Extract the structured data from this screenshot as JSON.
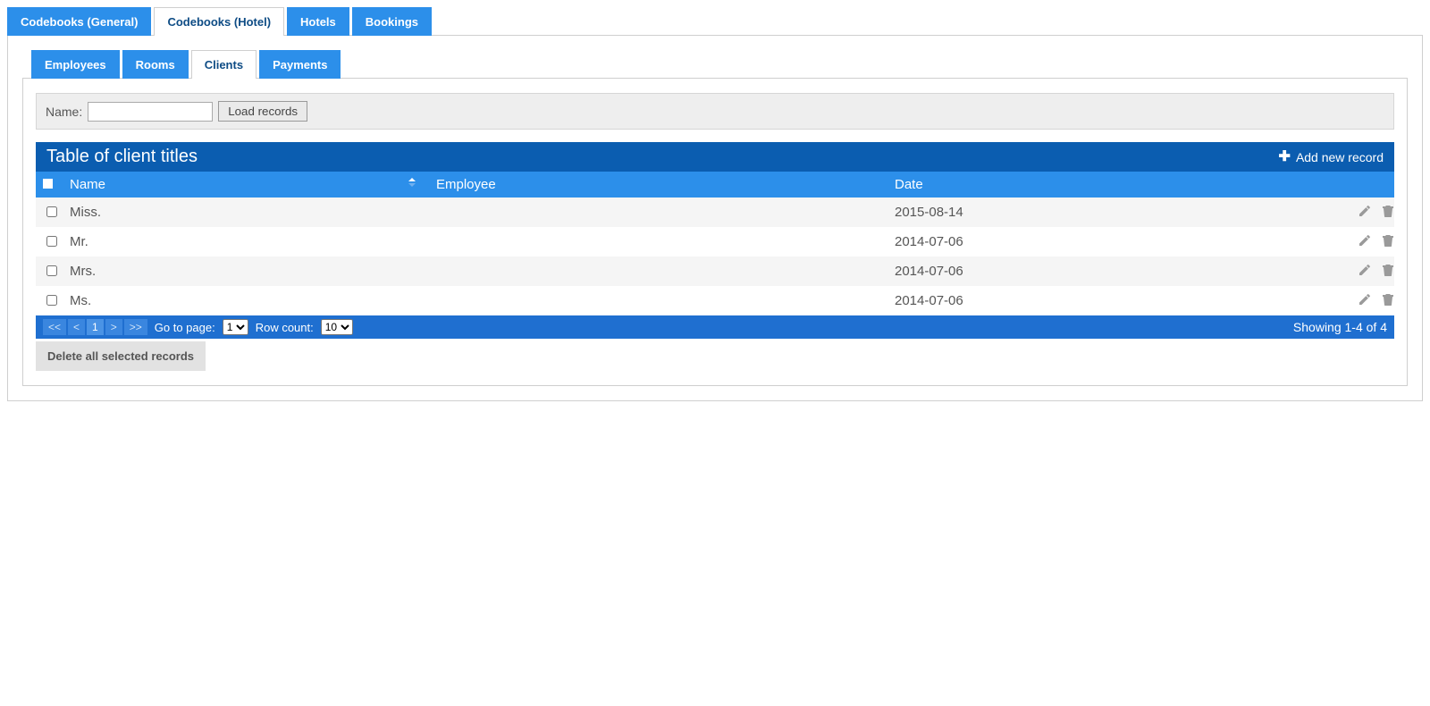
{
  "main_tabs": [
    {
      "label": "Codebooks (General)",
      "active": false
    },
    {
      "label": "Codebooks (Hotel)",
      "active": true
    },
    {
      "label": "Hotels",
      "active": false
    },
    {
      "label": "Bookings",
      "active": false
    }
  ],
  "sub_tabs": [
    {
      "label": "Employees",
      "active": false
    },
    {
      "label": "Rooms",
      "active": false
    },
    {
      "label": "Clients",
      "active": true
    },
    {
      "label": "Payments",
      "active": false
    }
  ],
  "filter": {
    "name_label": "Name:",
    "name_value": "",
    "load_btn": "Load records"
  },
  "table": {
    "title": "Table of client titles",
    "add_label": "Add new record",
    "headers": {
      "name": "Name",
      "employee": "Employee",
      "date": "Date"
    },
    "rows": [
      {
        "name": "Miss.",
        "employee": "",
        "date": "2015-08-14"
      },
      {
        "name": "Mr.",
        "employee": "",
        "date": "2014-07-06"
      },
      {
        "name": "Mrs.",
        "employee": "",
        "date": "2014-07-06"
      },
      {
        "name": "Ms.",
        "employee": "",
        "date": "2014-07-06"
      }
    ]
  },
  "pager": {
    "first": "<<",
    "prev": "<",
    "current_page": "1",
    "next": ">",
    "last": ">>",
    "goto_label": "Go to page:",
    "goto_value": "1",
    "rowcount_label": "Row count:",
    "rowcount_value": "10",
    "status": "Showing 1-4 of 4"
  },
  "delete_all": "Delete all selected records"
}
